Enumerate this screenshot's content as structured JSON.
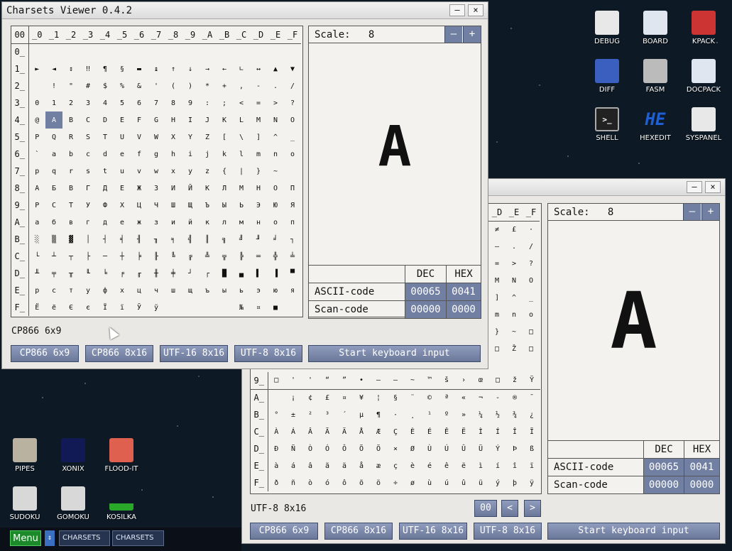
{
  "desktop": {
    "icons_right": [
      {
        "label": "DEBUG",
        "icon": "bug-icon"
      },
      {
        "label": "BOARD",
        "icon": "board-icon"
      },
      {
        "label": "KPACK",
        "icon": "wrench-icon"
      },
      {
        "label": "DIFF",
        "icon": "diff-icon"
      },
      {
        "label": "FASM",
        "icon": "fasm-icon"
      },
      {
        "label": "DOCPACK",
        "icon": "cabinet-icon"
      },
      {
        "label": "SHELL",
        "icon": "terminal-icon"
      },
      {
        "label": "HEXEDIT",
        "icon": "hex-icon",
        "glyph": "HE"
      },
      {
        "label": "SYSPANEL",
        "icon": "sliders-icon"
      }
    ],
    "icons_left": [
      {
        "label": "PIPES",
        "icon": "pipes-icon"
      },
      {
        "label": "XONIX",
        "icon": "xonix-icon"
      },
      {
        "label": "FLOOD-IT",
        "icon": "flood-icon"
      },
      {
        "label": "SUDOKU",
        "icon": "sudoku-icon"
      },
      {
        "label": "GOMOKU",
        "icon": "gomoku-icon"
      },
      {
        "label": "KOSILKA",
        "icon": "mower-icon"
      }
    ]
  },
  "taskbar": {
    "menu_label": "Menu",
    "arrows": "⇕",
    "items": [
      "CHARSETS",
      "CHARSETS"
    ]
  },
  "front_window": {
    "title": "Charsets Viewer 0.4.2",
    "minimize": "–",
    "close": "×",
    "grid": {
      "corner": "00",
      "col_headers": [
        "_0",
        "_1",
        "_2",
        "_3",
        "_4",
        "_5",
        "_6",
        "_7",
        "_8",
        "_9",
        "_A",
        "_B",
        "_C",
        "_D",
        "_E",
        "_F"
      ],
      "rows": [
        {
          "h": "0_",
          "c": [
            "",
            "",
            "",
            "",
            "",
            "",
            "",
            "",
            "",
            "",
            "",
            "",
            "",
            "",
            "",
            ""
          ]
        },
        {
          "h": "1_",
          "c": [
            "►",
            "◄",
            "↕",
            "‼",
            "¶",
            "§",
            "▬",
            "↨",
            "↑",
            "↓",
            "→",
            "←",
            "∟",
            "↔",
            "▲",
            "▼"
          ]
        },
        {
          "h": "2_",
          "c": [
            "",
            "!",
            "\"",
            "#",
            "$",
            "%",
            "&",
            "'",
            "(",
            ")",
            "*",
            "+",
            ",",
            "-",
            ".",
            "/"
          ]
        },
        {
          "h": "3_",
          "c": [
            "0",
            "1",
            "2",
            "3",
            "4",
            "5",
            "6",
            "7",
            "8",
            "9",
            ":",
            ";",
            "<",
            "=",
            ">",
            "?"
          ]
        },
        {
          "h": "4_",
          "c": [
            "@",
            "A",
            "B",
            "C",
            "D",
            "E",
            "F",
            "G",
            "H",
            "I",
            "J",
            "K",
            "L",
            "M",
            "N",
            "O"
          ]
        },
        {
          "h": "5_",
          "c": [
            "P",
            "Q",
            "R",
            "S",
            "T",
            "U",
            "V",
            "W",
            "X",
            "Y",
            "Z",
            "[",
            "\\",
            "]",
            "^",
            "_"
          ]
        },
        {
          "h": "6_",
          "c": [
            "`",
            "a",
            "b",
            "c",
            "d",
            "e",
            "f",
            "g",
            "h",
            "i",
            "j",
            "k",
            "l",
            "m",
            "n",
            "o"
          ]
        },
        {
          "h": "7_",
          "c": [
            "p",
            "q",
            "r",
            "s",
            "t",
            "u",
            "v",
            "w",
            "x",
            "y",
            "z",
            "{",
            "|",
            "}",
            "~",
            ""
          ]
        },
        {
          "h": "8_",
          "c": [
            "А",
            "Б",
            "В",
            "Г",
            "Д",
            "Е",
            "Ж",
            "З",
            "И",
            "Й",
            "К",
            "Л",
            "М",
            "Н",
            "О",
            "П"
          ]
        },
        {
          "h": "9_",
          "c": [
            "Р",
            "С",
            "Т",
            "У",
            "Ф",
            "Х",
            "Ц",
            "Ч",
            "Ш",
            "Щ",
            "Ъ",
            "Ы",
            "Ь",
            "Э",
            "Ю",
            "Я"
          ]
        },
        {
          "h": "A_",
          "c": [
            "а",
            "б",
            "в",
            "г",
            "д",
            "е",
            "ж",
            "з",
            "и",
            "й",
            "к",
            "л",
            "м",
            "н",
            "о",
            "п"
          ]
        },
        {
          "h": "B_",
          "c": [
            "░",
            "▒",
            "▓",
            "│",
            "┤",
            "╡",
            "╢",
            "╖",
            "╕",
            "╣",
            "║",
            "╗",
            "╝",
            "╜",
            "╛",
            "┐"
          ]
        },
        {
          "h": "C_",
          "c": [
            "└",
            "┴",
            "┬",
            "├",
            "─",
            "┼",
            "╞",
            "╟",
            "╚",
            "╔",
            "╩",
            "╦",
            "╠",
            "═",
            "╬",
            "╧"
          ]
        },
        {
          "h": "D_",
          "c": [
            "╨",
            "╤",
            "╥",
            "╙",
            "╘",
            "╒",
            "╓",
            "╫",
            "╪",
            "┘",
            "┌",
            "█",
            "▄",
            "▌",
            "▐",
            "▀"
          ]
        },
        {
          "h": "E_",
          "c": [
            "р",
            "с",
            "т",
            "у",
            "ф",
            "х",
            "ц",
            "ч",
            "ш",
            "щ",
            "ъ",
            "ы",
            "ь",
            "э",
            "ю",
            "я"
          ]
        },
        {
          "h": "F_",
          "c": [
            "Ё",
            "ё",
            "Є",
            "є",
            "Ї",
            "ї",
            "Ў",
            "ў",
            "",
            "",
            "",
            "",
            "№",
            "¤",
            "■",
            ""
          ]
        }
      ]
    },
    "scale_label": "Scale:",
    "scale_value": "8",
    "scale_minus": "–",
    "scale_plus": "+",
    "preview_char": "A",
    "codes": {
      "dec_header": "DEC",
      "hex_header": "HEX",
      "ascii_label": "ASCII-code",
      "ascii_dec": "00065",
      "ascii_hex": "0041",
      "scan_label": "Scan-code",
      "scan_dec": "00000",
      "scan_hex": "0000"
    },
    "status": "CP866 6x9",
    "buttons": [
      "CP866 6x9",
      "CP866 8x16",
      "UTF-16 8x16",
      "UTF-8 8x16"
    ],
    "keyboard_button": "Start keyboard input"
  },
  "back_window": {
    "minimize": "–",
    "close": "×",
    "top_headers": [
      "_D",
      "_E",
      "_F"
    ],
    "top_rows": [
      [
        "≠",
        "£",
        "·"
      ],
      [
        "–",
        ".",
        "/"
      ],
      [
        "=",
        ">",
        "?"
      ],
      [
        "M",
        "N",
        "O"
      ],
      [
        "]",
        "^",
        "_"
      ],
      [
        "m",
        "n",
        "o"
      ],
      [
        "}",
        "~",
        "□"
      ],
      [
        "□",
        "Ž",
        "□"
      ]
    ],
    "rows": [
      {
        "h": "9_",
        "c": [
          "□",
          "'",
          "'",
          "“",
          "”",
          "•",
          "–",
          "—",
          "~",
          "™",
          "š",
          "›",
          "œ",
          "□",
          "ž",
          "Ÿ"
        ]
      },
      {
        "h": "A_",
        "c": [
          "",
          "¡",
          "¢",
          "£",
          "¤",
          "¥",
          "¦",
          "§",
          "¨",
          "©",
          "ª",
          "«",
          "¬",
          "-",
          "®",
          "¯"
        ]
      },
      {
        "h": "B_",
        "c": [
          "°",
          "±",
          "²",
          "³",
          "´",
          "µ",
          "¶",
          "·",
          "¸",
          "¹",
          "º",
          "»",
          "¼",
          "½",
          "¾",
          "¿"
        ]
      },
      {
        "h": "C_",
        "c": [
          "À",
          "Á",
          "Â",
          "Ã",
          "Ä",
          "Å",
          "Æ",
          "Ç",
          "È",
          "É",
          "Ê",
          "Ë",
          "Ì",
          "Í",
          "Î",
          "Ï"
        ]
      },
      {
        "h": "D_",
        "c": [
          "Ð",
          "Ñ",
          "Ò",
          "Ó",
          "Ô",
          "Õ",
          "Ö",
          "×",
          "Ø",
          "Ù",
          "Ú",
          "Û",
          "Ü",
          "Ý",
          "Þ",
          "ß"
        ]
      },
      {
        "h": "E_",
        "c": [
          "à",
          "á",
          "â",
          "ã",
          "ä",
          "å",
          "æ",
          "ç",
          "è",
          "é",
          "ê",
          "ë",
          "ì",
          "í",
          "î",
          "ï"
        ]
      },
      {
        "h": "F_",
        "c": [
          "ð",
          "ñ",
          "ò",
          "ó",
          "ô",
          "õ",
          "ö",
          "÷",
          "ø",
          "ù",
          "ú",
          "û",
          "ü",
          "ý",
          "þ",
          "ÿ"
        ]
      }
    ],
    "scale_label": "Scale:",
    "scale_value": "8",
    "scale_minus": "–",
    "scale_plus": "+",
    "preview_char": "A",
    "codes": {
      "dec_header": "DEC",
      "hex_header": "HEX",
      "ascii_label": "ASCII-code",
      "ascii_dec": "00065",
      "ascii_hex": "0041",
      "scan_label": "Scan-code",
      "scan_dec": "00000",
      "scan_hex": "0000"
    },
    "status": "UTF-8 8x16",
    "page_value": "00",
    "prev": "<",
    "next": ">",
    "buttons": [
      "CP866 6x9",
      "CP866 8x16",
      "UTF-16 8x16",
      "UTF-8 8x16"
    ],
    "keyboard_button": "Start keyboard input"
  }
}
